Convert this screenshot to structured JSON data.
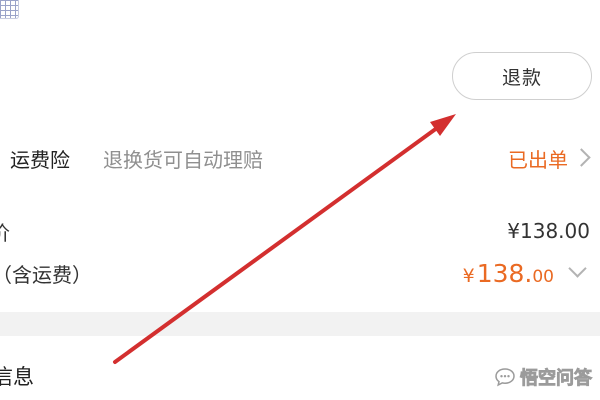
{
  "refund_button": {
    "label": "退款"
  },
  "insurance": {
    "name": "运费险",
    "description": "退换货可自动理赔",
    "status": "已出单",
    "status_color": "#ea6a23"
  },
  "price": {
    "label": "价",
    "value": "¥138.00"
  },
  "total": {
    "label": "（含运费）",
    "symbol": "¥",
    "integer": "138.",
    "decimal": "00",
    "color": "#ea6a23"
  },
  "info_section": {
    "label": "信息"
  },
  "watermark": {
    "text": "悟空问答"
  },
  "annotation": {
    "arrow_color": "#d32f2f",
    "arrow_icon": "red-arrow-icon"
  },
  "icons": {
    "chevron_right": "chevron-right-icon",
    "chevron_down": "chevron-down-icon",
    "watermark_logo": "chat-bubble-icon"
  }
}
